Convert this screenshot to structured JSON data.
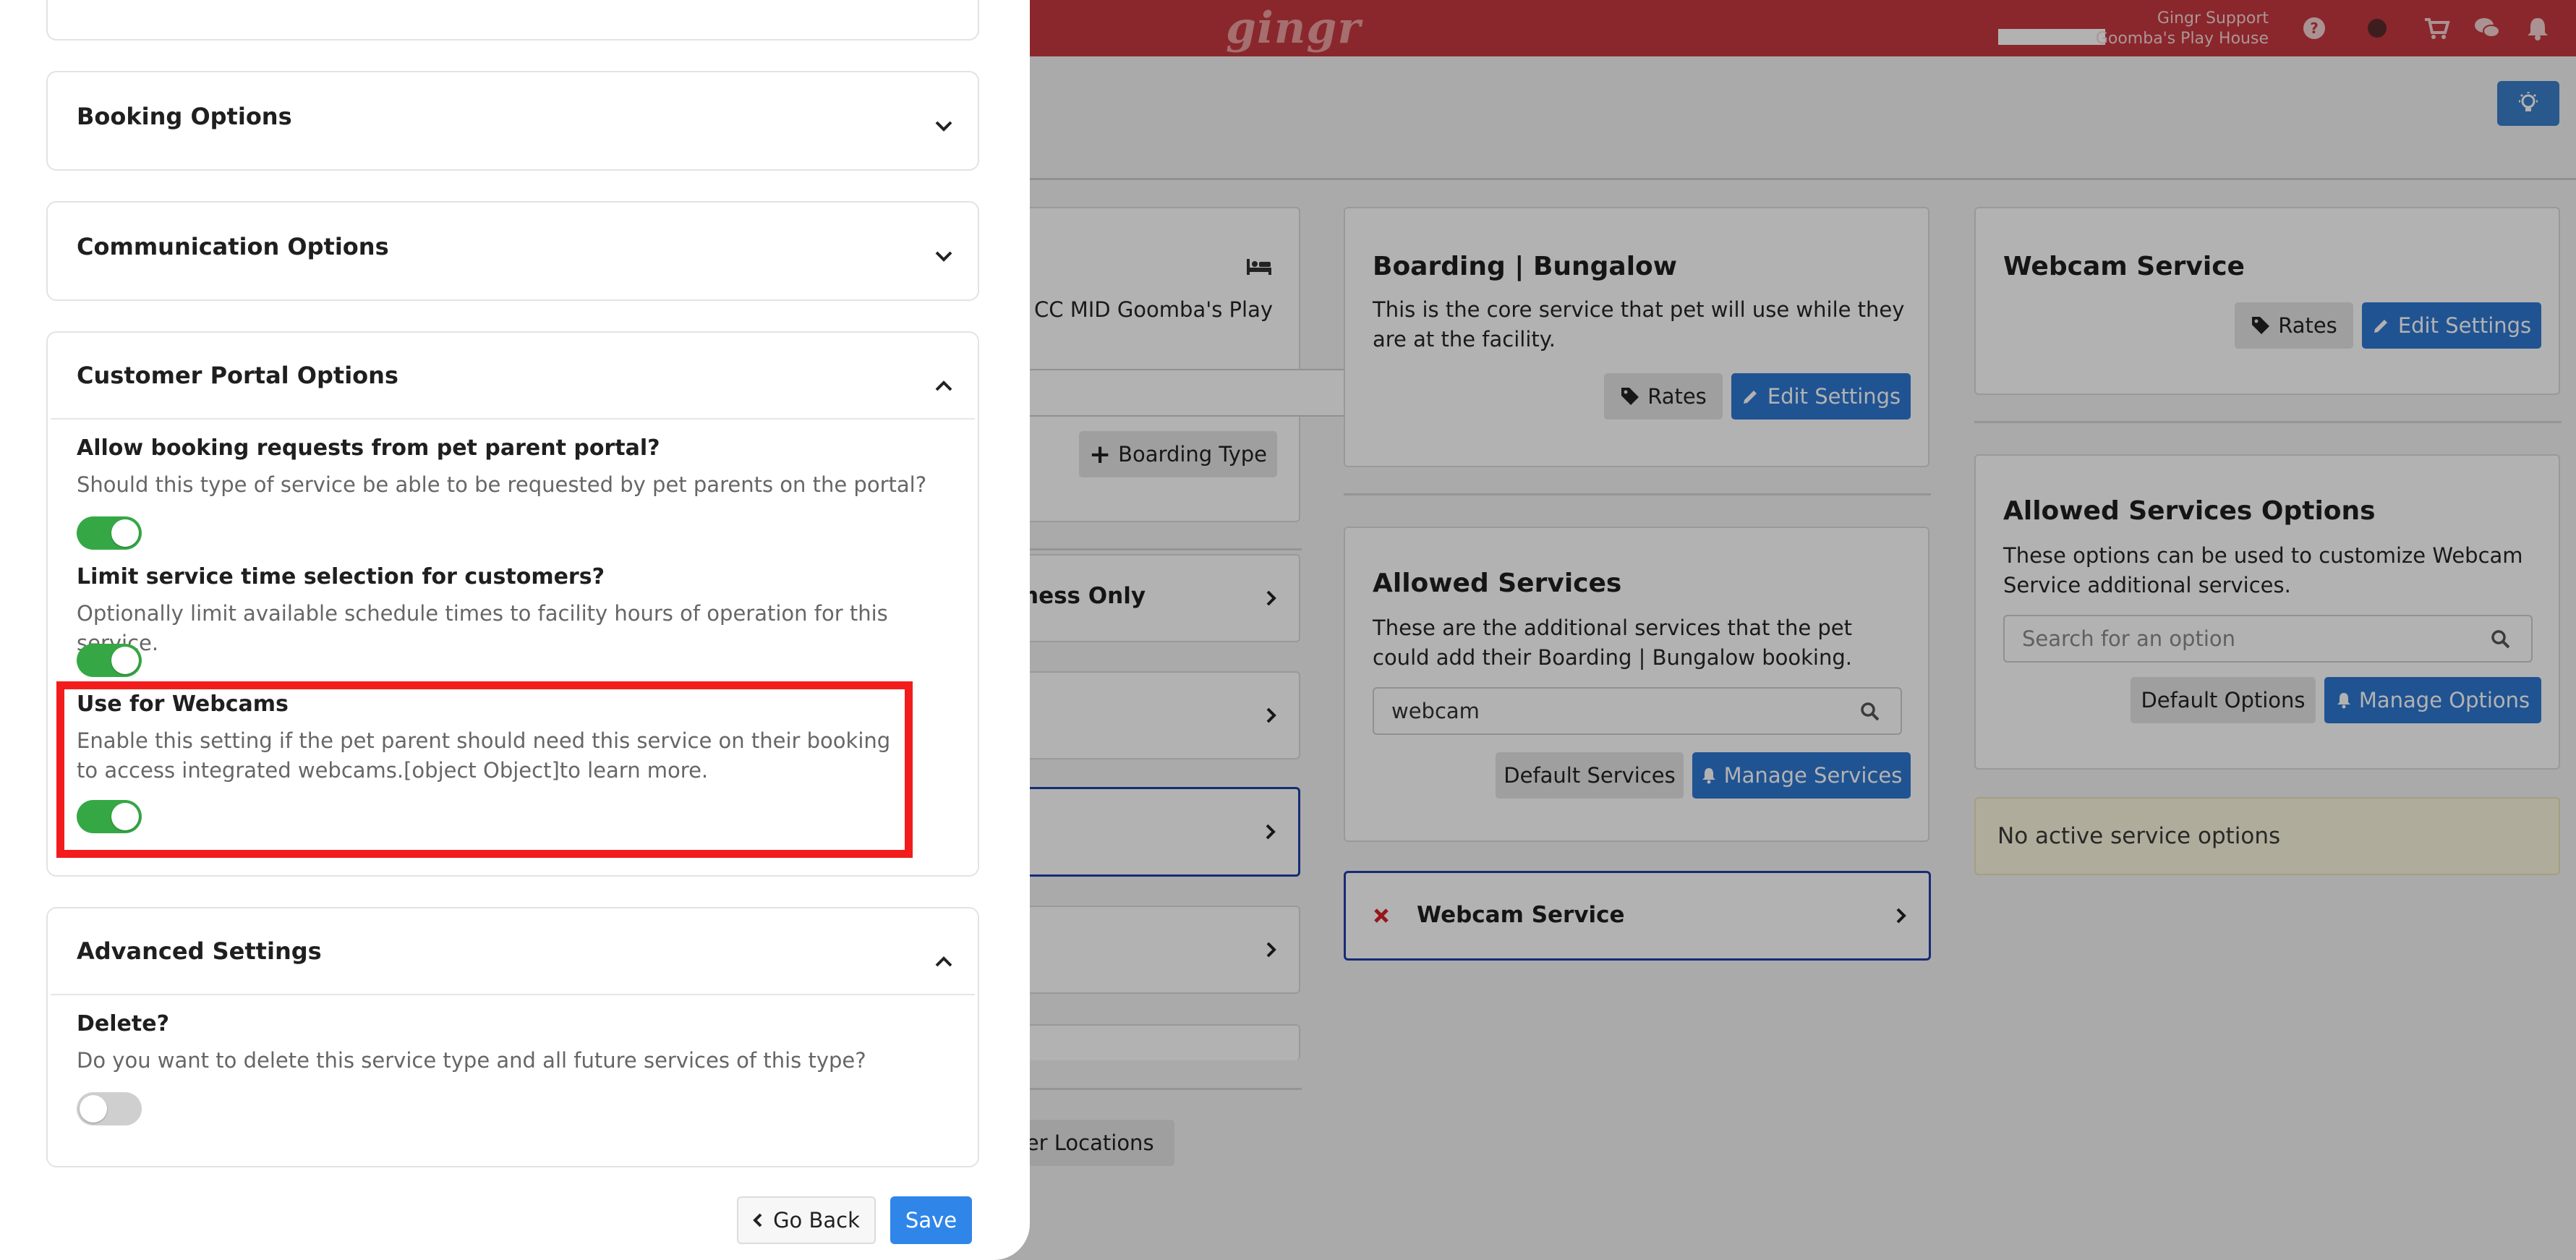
{
  "brand": {
    "logo": "gingr",
    "accent": "#c6383f",
    "primary": "#2f77d1",
    "toggle_on": "#35a845",
    "highlight": "#f21c1c"
  },
  "header": {
    "user_name": "Gingr Support",
    "location": "Goomba's Play House",
    "icons": [
      "help-icon",
      "status-dot-icon",
      "cart-icon",
      "chat-icon",
      "bell-icon"
    ],
    "tip_icon": "lightbulb-icon"
  },
  "background": {
    "col1": {
      "card_text": "CC MID Goomba's Play",
      "add_type_button": "Boarding Type",
      "rows": [
        "ness Only",
        "",
        "",
        ""
      ],
      "bottom_button": "her Locations"
    },
    "core_card": {
      "title": "Boarding | Bungalow",
      "description": "This is the core service that pet will use while they are at the facility.",
      "rates_button": "Rates",
      "edit_button": "Edit Settings"
    },
    "allowed_services": {
      "title": "Allowed Services",
      "description": "These are the additional services that the pet could add their Boarding | Bungalow booking.",
      "search_value": "webcam",
      "default_button": "Default Services",
      "manage_button": "Manage Services",
      "item": "Webcam Service"
    },
    "webcam_card": {
      "title": "Webcam Service",
      "rates_button": "Rates",
      "edit_button": "Edit Settings"
    },
    "options_card": {
      "title": "Allowed Services Options",
      "description": "These options can be used to customize Webcam Service additional services.",
      "search_placeholder": "Search for an option",
      "default_button": "Default Options",
      "manage_button": "Manage Options"
    },
    "notice": "No active service options"
  },
  "drawer": {
    "sections": {
      "booking": "Booking Options",
      "communication": "Communication Options",
      "portal": "Customer Portal Options",
      "advanced": "Advanced Settings"
    },
    "portal_settings": [
      {
        "title": "Allow booking requests from pet parent portal?",
        "description": "Should this type of service be able to be requested by pet parents on the portal?",
        "enabled": true
      },
      {
        "title": "Limit service time selection for customers?",
        "description": "Optionally limit available schedule times to facility hours of operation for this service.",
        "enabled": true
      },
      {
        "title": "Use for Webcams",
        "description": "Enable this setting if the pet parent should need this service on their booking to access integrated webcams.[object Object]to learn more.",
        "enabled": true
      }
    ],
    "advanced_settings": [
      {
        "title": "Delete?",
        "description": "Do you want to delete this service type and all future services of this type?",
        "enabled": false
      }
    ],
    "go_back": "Go Back",
    "save": "Save"
  }
}
